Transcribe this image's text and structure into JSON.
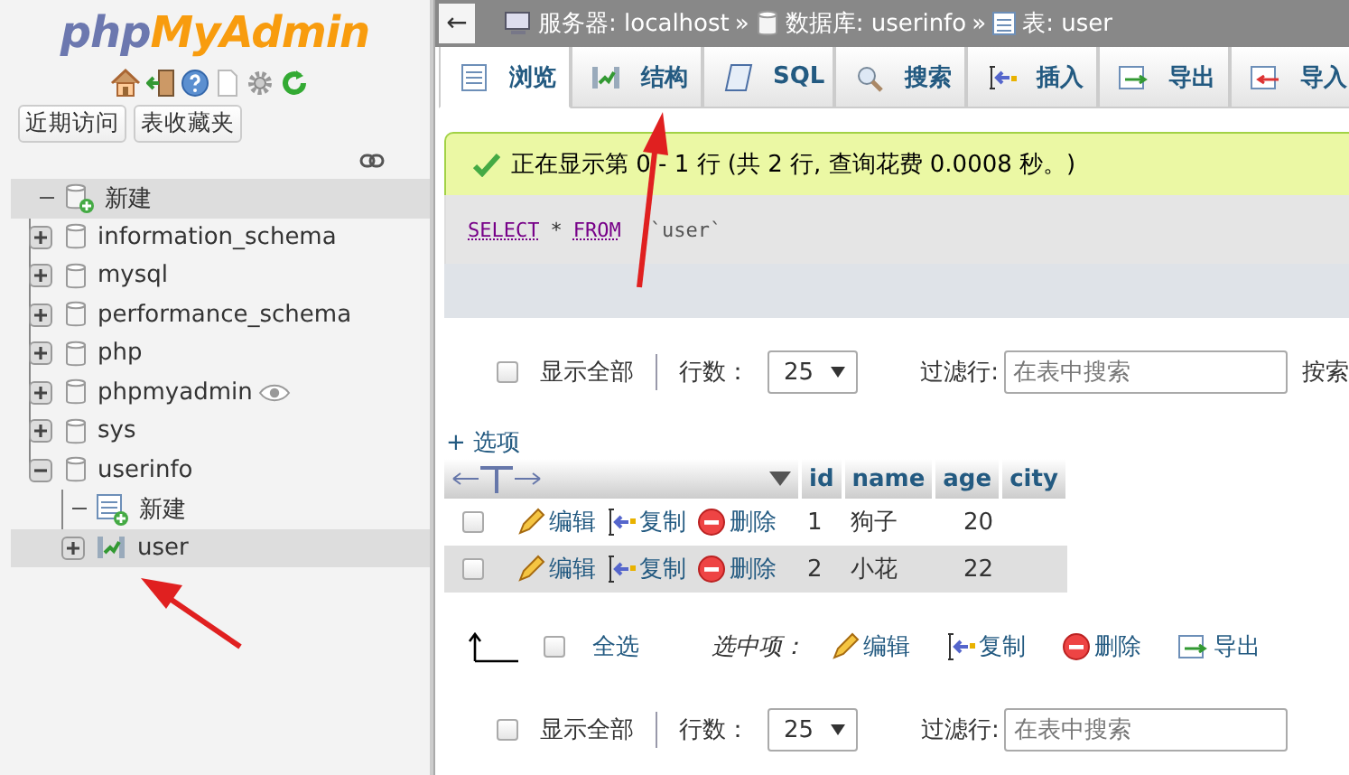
{
  "sidebar": {
    "logo": {
      "part_1": "php",
      "part_2": "MyAdmin"
    },
    "buttons": [
      "近期访问",
      "表收藏夹"
    ],
    "tree": [
      {
        "label": "新建",
        "kind": "new-db",
        "selected": true
      },
      {
        "label": "information_schema",
        "kind": "db",
        "expanded": false,
        "selected": false
      },
      {
        "label": "mysql",
        "kind": "db",
        "expanded": false,
        "selected": false
      },
      {
        "label": "performance_schema",
        "kind": "db",
        "expanded": false,
        "selected": false
      },
      {
        "label": "php",
        "kind": "db",
        "expanded": false,
        "selected": false
      },
      {
        "label": "phpmyadmin",
        "kind": "db",
        "expanded": false,
        "selected": false,
        "eye": true
      },
      {
        "label": "sys",
        "kind": "db",
        "expanded": false,
        "selected": false
      },
      {
        "label": "userinfo",
        "kind": "db",
        "expanded": true,
        "selected": false,
        "children": [
          {
            "label": "新建",
            "kind": "new-table",
            "selected": false
          },
          {
            "label": "user",
            "kind": "table",
            "expanded": false,
            "selected": true
          }
        ]
      }
    ]
  },
  "breadcrumb": {
    "back": "←",
    "separator": "»",
    "items": [
      {
        "kind": "server",
        "label": "服务器: localhost"
      },
      {
        "kind": "database",
        "label": "数据库: userinfo"
      },
      {
        "kind": "table",
        "label": "表: user"
      }
    ]
  },
  "tabs": [
    {
      "label": "浏览",
      "kind": "browse",
      "selected": true
    },
    {
      "label": "结构",
      "kind": "structure",
      "selected": false
    },
    {
      "label": "SQL",
      "kind": "sql",
      "selected": false
    },
    {
      "label": "搜索",
      "kind": "search",
      "selected": false
    },
    {
      "label": "插入",
      "kind": "insert",
      "selected": false
    },
    {
      "label": "导出",
      "kind": "export",
      "selected": false
    },
    {
      "label": "导入",
      "kind": "import",
      "selected": false
    }
  ],
  "message": "正在显示第 0 - 1 行 (共 2 行, 查询花费 0.0008 秒。)",
  "sql": [
    {
      "text": "SELECT",
      "kind": "keyword"
    },
    {
      "text": "*",
      "kind": "operator"
    },
    {
      "text": "FROM",
      "kind": "keyword"
    },
    {
      "text": "`user`",
      "kind": "identifier"
    }
  ],
  "top_controls": {
    "show_all": {
      "label": "显示全部",
      "checked": false
    },
    "rows_label": "行数：",
    "rows_value": "25",
    "filter_label": "过滤行:",
    "filter_placeholder": "在表中搜索",
    "search_by_key": "按索"
  },
  "options_link": "+ 选项",
  "table": {
    "columns": [
      "id",
      "name",
      "age",
      "city"
    ],
    "rows": [
      {
        "checked": false,
        "actions": [
          "编辑",
          "复制",
          "删除"
        ],
        "cells": [
          "1",
          "狗子",
          "20"
        ]
      },
      {
        "checked": false,
        "actions": [
          "编辑",
          "复制",
          "删除"
        ],
        "cells": [
          "2",
          "小花",
          "22"
        ]
      }
    ]
  },
  "bulk": {
    "select_all": {
      "label": "全选",
      "checked": false
    },
    "with_selected": "选中项：",
    "actions": [
      {
        "label": "编辑",
        "kind": "edit"
      },
      {
        "label": "复制",
        "kind": "copy"
      },
      {
        "label": "删除",
        "kind": "delete"
      },
      {
        "label": "导出",
        "kind": "export"
      }
    ]
  },
  "bottom_controls": {
    "show_all": {
      "label": "显示全部",
      "checked": false
    },
    "rows_label": "行数：",
    "rows_value": "25",
    "filter_label": "过滤行:",
    "filter_placeholder": "在表中搜索"
  }
}
